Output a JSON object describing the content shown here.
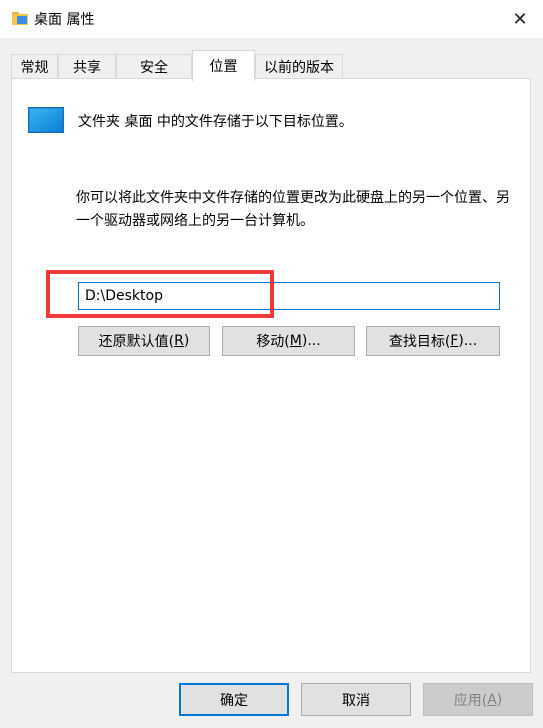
{
  "window": {
    "title": "桌面 属性",
    "close_symbol": "✕"
  },
  "tabs": [
    {
      "label": "常规"
    },
    {
      "label": "共享"
    },
    {
      "label": "安全"
    },
    {
      "label": "位置",
      "active": true
    },
    {
      "label": "以前的版本"
    }
  ],
  "location": {
    "info_text": "文件夹 桌面 中的文件存储于以下目标位置。",
    "description": "你可以将此文件夹中文件存储的位置更改为此硬盘上的另一个位置、另一个驱动器或网络上的另一台计算机。",
    "path_value": "D:\\Desktop",
    "restore_button": {
      "text": "还原默认值(",
      "key": "R",
      "suffix": ")"
    },
    "move_button": {
      "text": "移动(",
      "key": "M",
      "suffix": ")..."
    },
    "find_button": {
      "text": "查找目标(",
      "key": "F",
      "suffix": ")..."
    }
  },
  "footer": {
    "ok_label": "确定",
    "cancel_label": "取消",
    "apply_button": {
      "text": "应用(",
      "key": "A",
      "suffix": ")"
    }
  },
  "colors": {
    "accent": "#0078d7",
    "highlight_box": "#f33a3a"
  },
  "icons": {
    "title": "folder-icon",
    "monitor": "monitor-icon",
    "close": "close-icon"
  }
}
